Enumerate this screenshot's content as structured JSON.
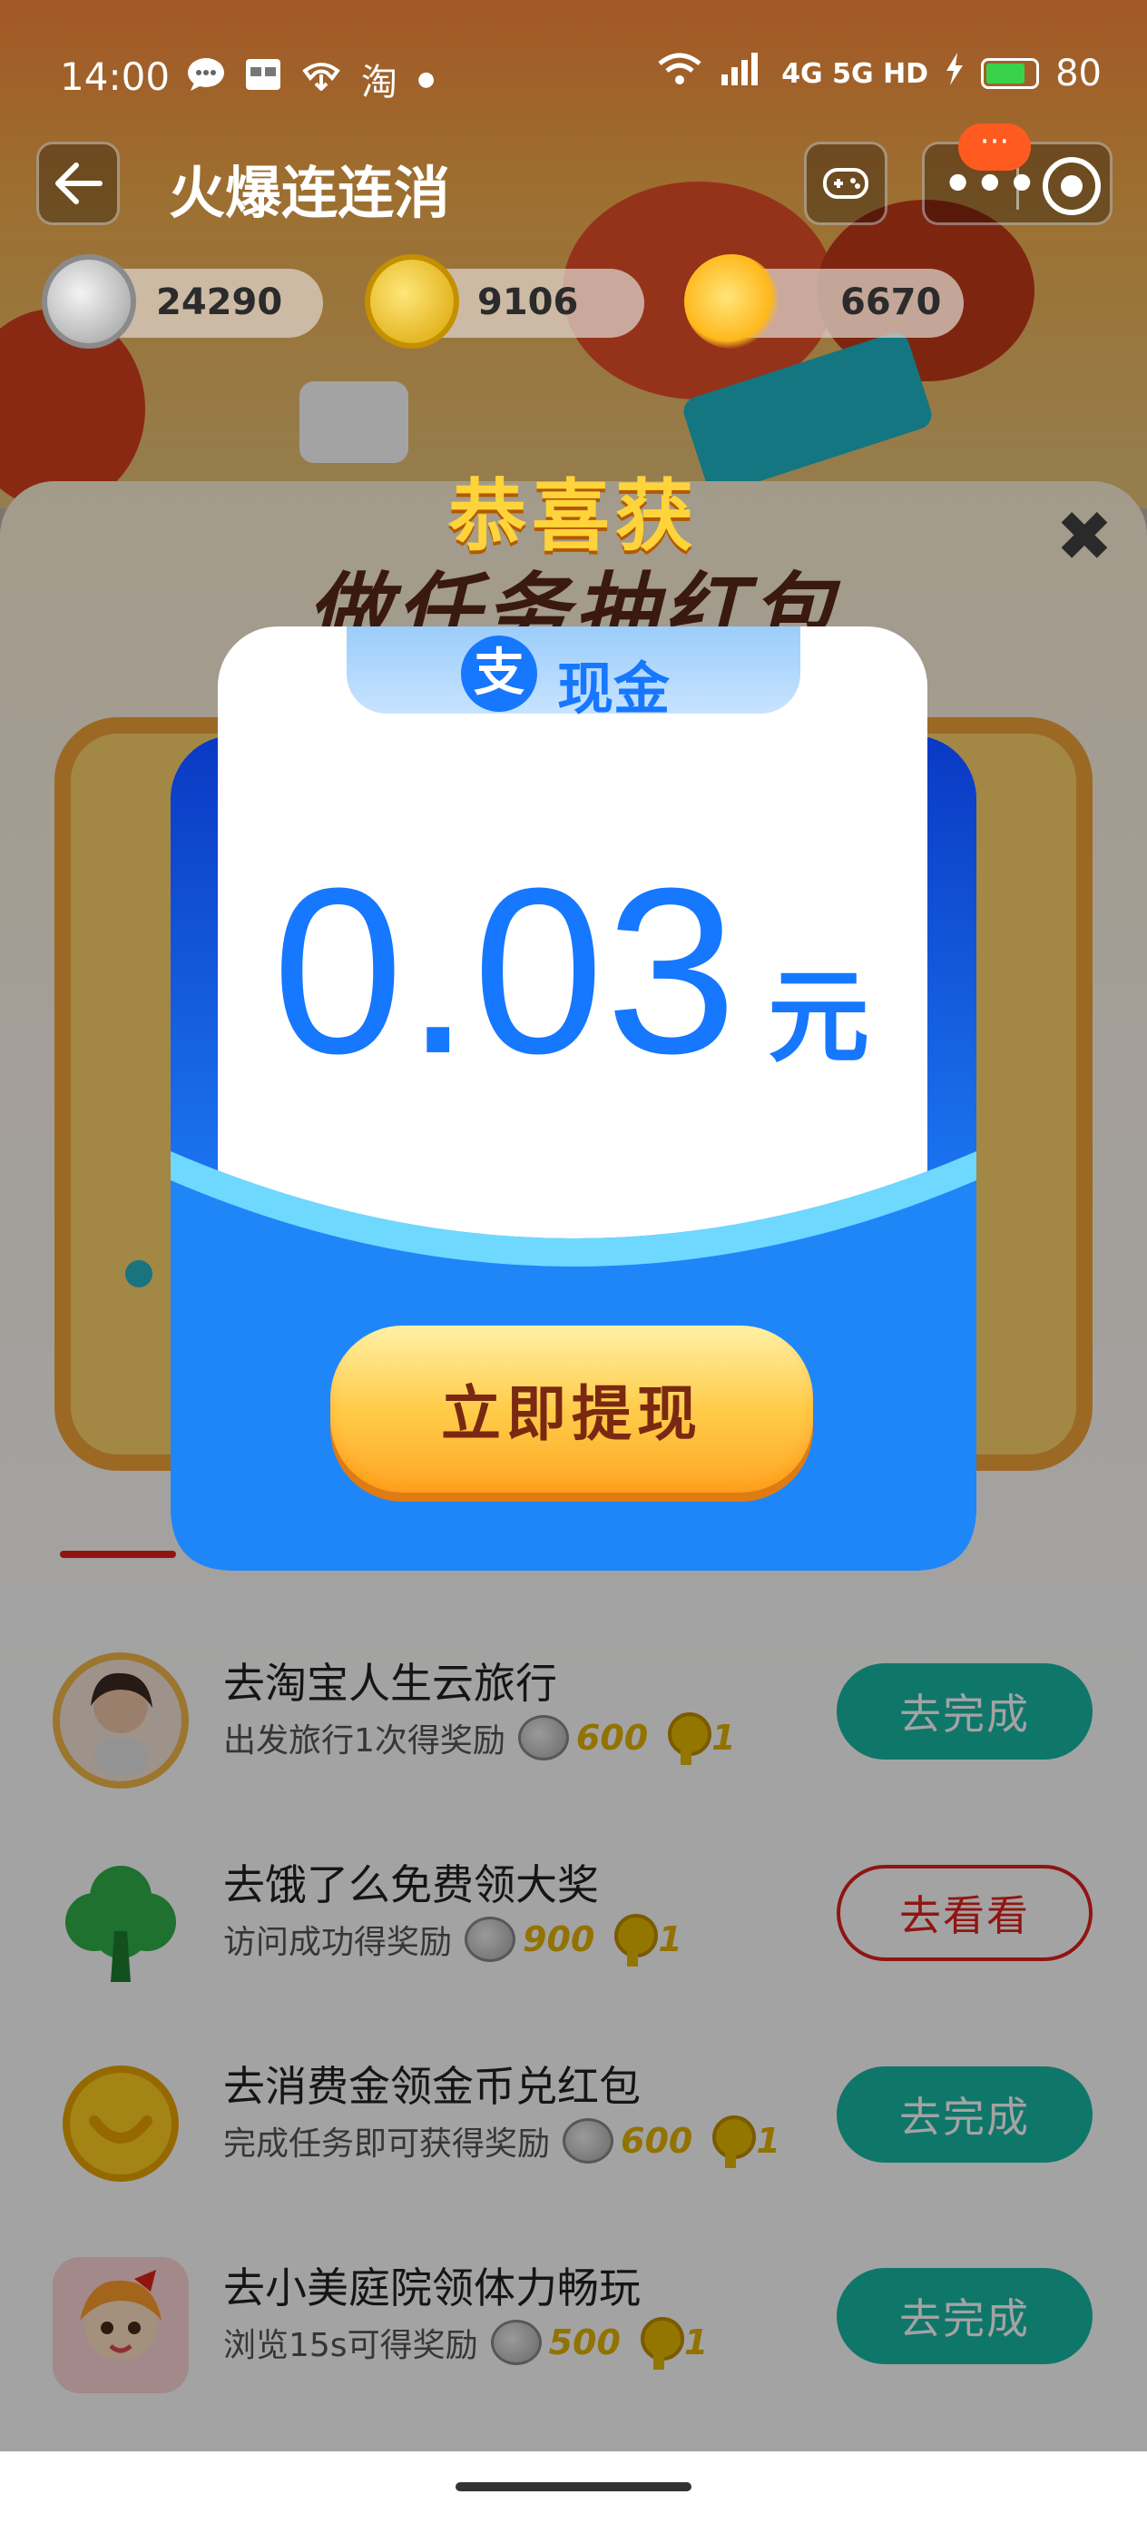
{
  "status_bar": {
    "time": "14:00",
    "left_icons": [
      "chat-bubble",
      "card-icon",
      "call-icon",
      "淘"
    ],
    "network": "4G 5G HD",
    "battery": "80",
    "battery_level": 0.8
  },
  "title_bar": {
    "title": "火爆连连消",
    "badge": "···"
  },
  "currencies": [
    {
      "icon": "silver-coin",
      "value": "24290"
    },
    {
      "icon": "gold-coin",
      "value": "9106"
    },
    {
      "icon": "sun-energy",
      "value": "6670"
    }
  ],
  "panel": {
    "title": "做任务抽红包"
  },
  "dialog": {
    "heading": "恭喜获",
    "badge_logo": "支",
    "badge_label": "现金",
    "amount": "0.03",
    "unit": "元",
    "cta_label": "立即提现",
    "close": "✖"
  },
  "tasks": [
    {
      "title": "去淘宝人生云旅行",
      "desc": "出发旅行1次得奖励",
      "coins": "600",
      "keys": "1",
      "button": "去完成",
      "style": "fill"
    },
    {
      "title": "去饿了么免费领大奖",
      "desc": "访问成功得奖励",
      "coins": "900",
      "keys": "1",
      "button": "去看看",
      "style": "outline"
    },
    {
      "title": "去消费金领金币兑红包",
      "desc": "完成任务即可获得奖励",
      "coins": "600",
      "keys": "1",
      "button": "去完成",
      "style": "fill"
    },
    {
      "title": "去小美庭院领体力畅玩",
      "desc": "浏览15s可得奖励",
      "coins": "500",
      "keys": "1",
      "button": "去完成",
      "style": "fill"
    }
  ],
  "colors": {
    "accent_blue": "#1677ff",
    "task_button": "#18b9a6",
    "outline_red": "#e2211c",
    "gold": "#ffd43a"
  }
}
